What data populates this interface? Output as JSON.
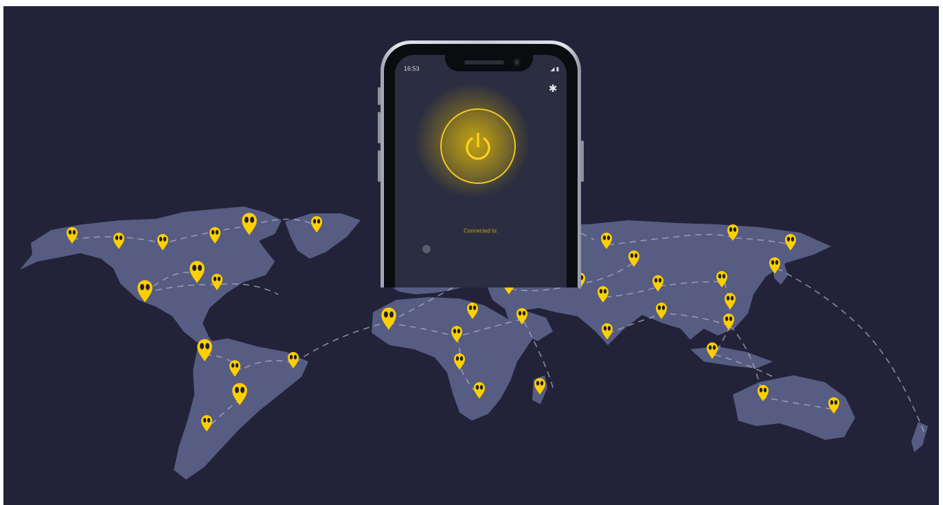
{
  "phone": {
    "status_time": "16:53",
    "status_icons": "◢ ▮",
    "connected_label": "Connected to:",
    "settings_icon": "gear-icon",
    "power_icon": "power-icon"
  },
  "map": {
    "server_pin_icon": "location-pin-icon",
    "pin_count": 48
  },
  "colors": {
    "background": "#222339",
    "land": "#575c82",
    "pin": "#ffcf00",
    "route": "#b3b6c6"
  }
}
